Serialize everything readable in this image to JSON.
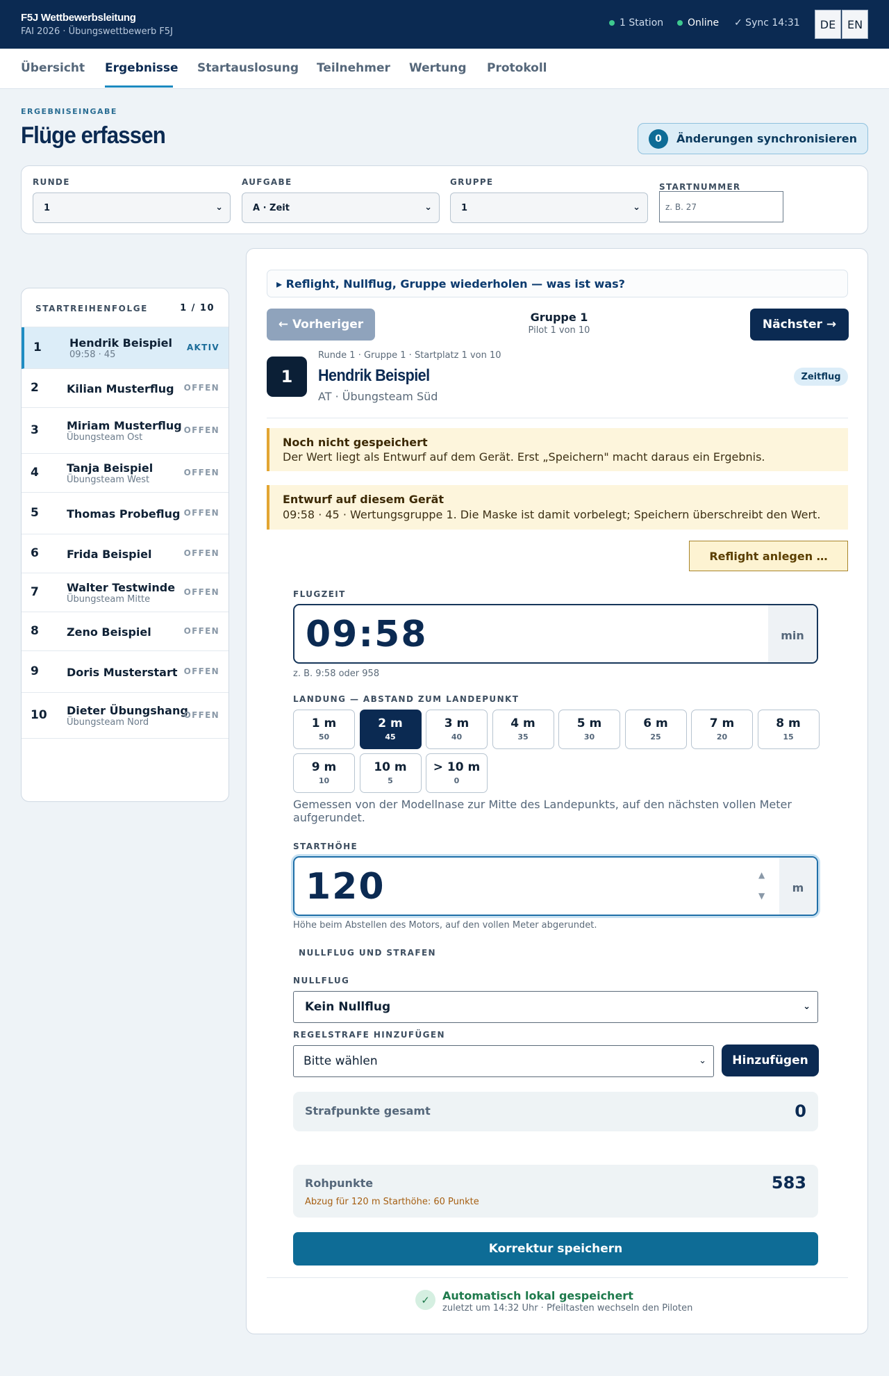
{
  "app": {
    "title": "F5J Wettbewerbsleitung",
    "subtitle": "FAI 2026 · Übungswettbewerb F5J"
  },
  "status": {
    "stations": "1 Station",
    "online": "Online",
    "sync": "✓ Sync 14:31"
  },
  "langs": [
    "DE",
    "EN"
  ],
  "nav": [
    "Übersicht",
    "Ergebnisse",
    "Startauslosung",
    "Teilnehmer",
    "Wertung",
    "Protokoll"
  ],
  "page": {
    "eyebrow": "ERGEBNISEINGABE",
    "title": "Flüge erfassen",
    "sync_count": "0",
    "sync_label": "Änderungen synchronisieren"
  },
  "filters": {
    "runde": {
      "label": "RUNDE",
      "value": "1"
    },
    "aufgabe": {
      "label": "AUFGABE",
      "value": "A · Zeit"
    },
    "gruppe": {
      "label": "GRUPPE",
      "value": "1"
    },
    "startnummer": {
      "label": "STARTNUMMER",
      "placeholder": "z. B. 27"
    }
  },
  "sidebar": {
    "title": "STARTREIHENFOLGE",
    "count": "1 / 10",
    "pilots": [
      {
        "num": "1",
        "name": "Hendrik Beispiel",
        "meta": "09:58 · 45",
        "state": "AKTIV"
      },
      {
        "num": "2",
        "name": "Kilian Musterflug",
        "meta": "",
        "state": "OFFEN"
      },
      {
        "num": "3",
        "name": "Miriam Musterflug",
        "meta": "Übungsteam Ost",
        "state": "OFFEN"
      },
      {
        "num": "4",
        "name": "Tanja Beispiel",
        "meta": "Übungsteam West",
        "state": "OFFEN"
      },
      {
        "num": "5",
        "name": "Thomas Probeflug",
        "meta": "",
        "state": "OFFEN"
      },
      {
        "num": "6",
        "name": "Frida Beispiel",
        "meta": "",
        "state": "OFFEN"
      },
      {
        "num": "7",
        "name": "Walter Testwinde",
        "meta": "Übungsteam Mitte",
        "state": "OFFEN"
      },
      {
        "num": "8",
        "name": "Zeno Beispiel",
        "meta": "",
        "state": "OFFEN"
      },
      {
        "num": "9",
        "name": "Doris Musterstart",
        "meta": "",
        "state": "OFFEN"
      },
      {
        "num": "10",
        "name": "Dieter Übungshang",
        "meta": "Übungsteam Nord",
        "state": "OFFEN"
      }
    ]
  },
  "panel": {
    "help": "▸ Reflight, Nullflug, Gruppe wiederholen — was ist was?",
    "prev": "← Vorheriger",
    "next": "Nächster →",
    "group": "Gruppe 1",
    "group_sub": "Pilot 1 von 10",
    "pilot": {
      "number": "1",
      "breadcrumb": "Runde 1 · Gruppe 1 · Startplatz 1 von 10",
      "name": "Hendrik Beispiel",
      "team": "AT · Übungsteam Süd",
      "tag": "Zeitflug"
    },
    "note1": {
      "title": "Noch nicht gespeichert",
      "body": "Der Wert liegt als Entwurf auf dem Gerät. Erst „Speichern\" macht daraus ein Ergebnis."
    },
    "note2": {
      "title": "Entwurf auf diesem Gerät",
      "body": "09:58 · 45 · Wertungsgruppe 1. Die Maske ist damit vorbelegt; Speichern überschreibt den Wert."
    },
    "reflight": "Reflight anlegen …",
    "flugzeit": {
      "label": "FLUGZEIT",
      "value": "09:58",
      "unit": "min",
      "hint": "z. B. 9:58 oder 958"
    },
    "landung": {
      "label": "LANDUNG — ABSTAND ZUM LANDEPUNKT",
      "selected": 1,
      "options": [
        {
          "d": "1 m",
          "p": "50"
        },
        {
          "d": "2 m",
          "p": "45"
        },
        {
          "d": "3 m",
          "p": "40"
        },
        {
          "d": "4 m",
          "p": "35"
        },
        {
          "d": "5 m",
          "p": "30"
        },
        {
          "d": "6 m",
          "p": "25"
        },
        {
          "d": "7 m",
          "p": "20"
        },
        {
          "d": "8 m",
          "p": "15"
        },
        {
          "d": "9 m",
          "p": "10"
        },
        {
          "d": "10 m",
          "p": "5"
        },
        {
          "d": "> 10 m",
          "p": "0"
        }
      ],
      "desc": "Gemessen von der Modellnase zur Mitte des Landepunkts, auf den nächsten vollen Meter aufgerundet."
    },
    "starthoehe": {
      "label": "STARTHÖHE",
      "value": "120",
      "unit": "m",
      "hint": "Höhe beim Abstellen des Motors, auf den vollen Meter abgerundet."
    },
    "section_penalties": "NULLFLUG UND STRAFEN",
    "nullflug": {
      "label": "NULLFLUG",
      "value": "Kein Nullflug"
    },
    "regelstrafe": {
      "label": "REGELSTRAFE HINZUFÜGEN",
      "value": "Bitte wählen",
      "add": "Hinzufügen"
    },
    "strafpunkte": {
      "label": "Strafpunkte gesamt",
      "value": "0"
    },
    "rohpunkte": {
      "label": "Rohpunkte",
      "value": "583",
      "note": "Abzug für 120 m Starthöhe: 60 Punkte"
    },
    "save": "Korrektur speichern",
    "autosave": {
      "title": "Automatisch lokal gespeichert",
      "sub": "zuletzt um 14:32 Uhr · Pfeiltasten wechseln den Piloten"
    }
  },
  "colors": {
    "header": "#0b2a52",
    "accent": "#0e6c96",
    "warning": "#e2a532",
    "success": "#1e7a4c"
  }
}
